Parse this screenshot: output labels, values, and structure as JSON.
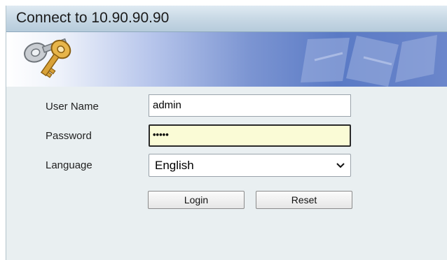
{
  "window": {
    "title": "Connect to 10.90.90.90"
  },
  "banner": {
    "icon": "keys-icon"
  },
  "form": {
    "username_label": "User Name",
    "username_value": "admin",
    "password_label": "Password",
    "password_masked": "•••••",
    "language_label": "Language",
    "language_selected": "English"
  },
  "buttons": {
    "login": "Login",
    "reset": "Reset"
  },
  "colors": {
    "panel_background": "#e9eff1",
    "banner_blue": "#5a7ac5",
    "password_focus_bg": "#fafbd6"
  }
}
